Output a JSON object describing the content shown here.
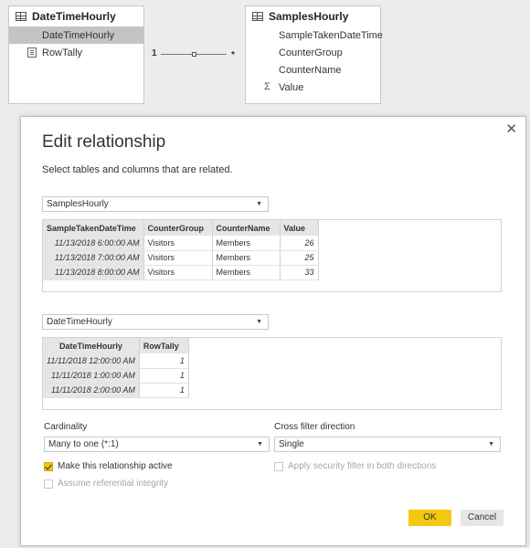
{
  "model": {
    "left_table": {
      "title": "DateTimeHourly",
      "fields": [
        "DateTimeHourly",
        "RowTally"
      ]
    },
    "right_table": {
      "title": "SamplesHourly",
      "fields": [
        "SampleTakenDateTime",
        "CounterGroup",
        "CounterName",
        "Value"
      ]
    },
    "relationship": {
      "from_cardinality": "1",
      "to_cardinality": "*"
    }
  },
  "dialog": {
    "title": "Edit relationship",
    "subtitle": "Select tables and columns that are related.",
    "close_glyph": "✕",
    "table1": {
      "selected": "SamplesHourly",
      "columns": [
        "SampleTakenDateTime",
        "CounterGroup",
        "CounterName",
        "Value"
      ],
      "rows": [
        [
          "11/13/2018 6:00:00 AM",
          "Visitors",
          "Members",
          "26"
        ],
        [
          "11/13/2018 7:00:00 AM",
          "Visitors",
          "Members",
          "25"
        ],
        [
          "11/13/2018 8:00:00 AM",
          "Visitors",
          "Members",
          "33"
        ]
      ]
    },
    "table2": {
      "selected": "DateTimeHourly",
      "columns": [
        "DateTimeHourly",
        "RowTally"
      ],
      "rows": [
        [
          "11/11/2018 12:00:00 AM",
          "1"
        ],
        [
          "11/11/2018 1:00:00 AM",
          "1"
        ],
        [
          "11/11/2018 2:00:00 AM",
          "1"
        ]
      ]
    },
    "cardinality": {
      "label": "Cardinality",
      "value": "Many to one (*:1)"
    },
    "cross_filter": {
      "label": "Cross filter direction",
      "value": "Single"
    },
    "options": {
      "active_label": "Make this relationship active",
      "active_checked": true,
      "security_label": "Apply security filter in both directions",
      "security_checked": false,
      "integrity_label": "Assume referential integrity",
      "integrity_checked": false
    },
    "buttons": {
      "ok": "OK",
      "cancel": "Cancel"
    }
  },
  "colors": {
    "accent": "#f2c811",
    "selected_field": "#c4c4c4",
    "header_cell": "#e6e6e6"
  }
}
